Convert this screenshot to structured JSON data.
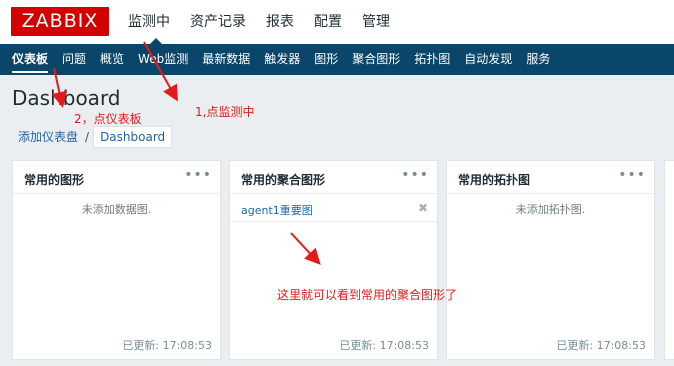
{
  "header": {
    "logo": "ZABBIX",
    "menu": [
      {
        "label": "监测中",
        "active": true
      },
      {
        "label": "资产记录"
      },
      {
        "label": "报表"
      },
      {
        "label": "配置"
      },
      {
        "label": "管理"
      }
    ]
  },
  "subnav": {
    "items": [
      {
        "label": "仪表板",
        "active": true
      },
      {
        "label": "问题"
      },
      {
        "label": "概览"
      },
      {
        "label": "Web监测"
      },
      {
        "label": "最新数据"
      },
      {
        "label": "触发器"
      },
      {
        "label": "图形"
      },
      {
        "label": "聚合图形"
      },
      {
        "label": "拓扑图"
      },
      {
        "label": "自动发现"
      },
      {
        "label": "服务"
      }
    ]
  },
  "page": {
    "title": "Dashboard",
    "breadcrumb": {
      "link": "添加仪表盘",
      "separator": "/",
      "current": "Dashboard"
    }
  },
  "widgets": [
    {
      "title": "常用的图形",
      "empty_text": "未添加数据图.",
      "footer": "已更新: 17:08:53"
    },
    {
      "title": "常用的聚合图形",
      "item": "agent1重要图",
      "remove_icon": "close-icon",
      "footer": "已更新: 17:08:53"
    },
    {
      "title": "常用的拓扑图",
      "empty_text": "未添加拓扑图.",
      "footer": "已更新: 17:08:53"
    }
  ],
  "widget_menu_icon": "more-dots-icon",
  "annotations": {
    "step1": "1,点监测中",
    "step2": "2，点仪表板",
    "note": "这里就可以看到常用的聚合图形了",
    "color": "#e31b1b"
  },
  "colors": {
    "logo": "#d40000",
    "subnav": "#0a466a",
    "link": "#1f65a6",
    "background": "#ebeef0"
  }
}
